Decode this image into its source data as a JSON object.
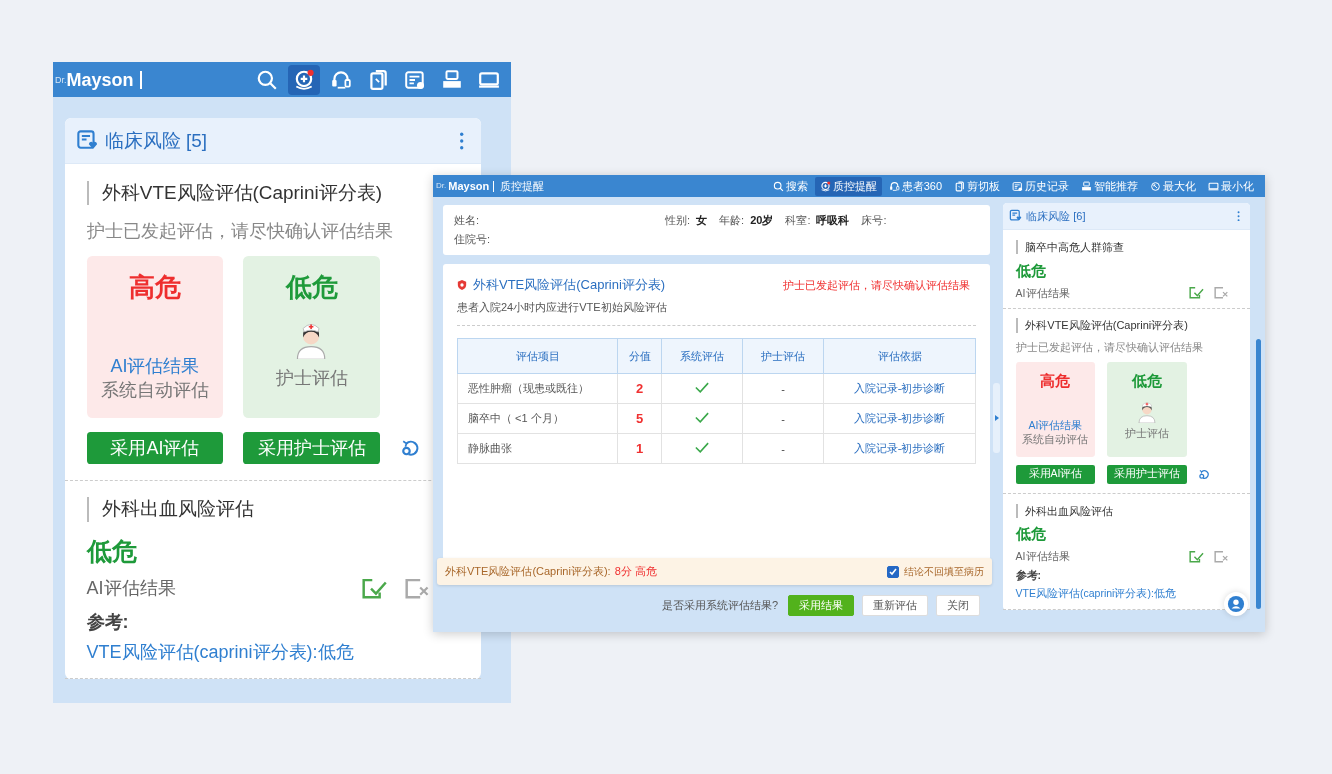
{
  "left_window": {
    "brand_prefix": "Dr.",
    "brand": "Mayson",
    "toolbar": [
      {
        "kind": "search",
        "selected": false
      },
      {
        "kind": "quality",
        "selected": true
      },
      {
        "kind": "patient",
        "selected": false
      },
      {
        "kind": "clipboard",
        "selected": false
      },
      {
        "kind": "history",
        "selected": false
      },
      {
        "kind": "recommend",
        "selected": false
      },
      {
        "kind": "minimize",
        "selected": false
      }
    ],
    "panel": {
      "title": "临床风险",
      "count": "[5]",
      "items": [
        {
          "kind": "dual",
          "title": "外科VTE风险评估(Caprini评分表)",
          "note": "护士已发起评估，请尽快确认评估结果",
          "cards": [
            {
              "kind": "ai",
              "high_risk": true,
              "rating": "高危",
              "source": "AI评估结果",
              "caption": "系统自动评估"
            },
            {
              "kind": "nurse",
              "high_risk": false,
              "rating": "低危",
              "caption": "护士评估"
            }
          ],
          "buttons": [
            "采用AI评估",
            "采用护士评估"
          ]
        },
        {
          "kind": "single",
          "title": "外科出血风险评估",
          "high_risk": false,
          "rating": "低危",
          "source": "AI评估结果",
          "reference_label": "参考:",
          "reference": "VTE风险评估(caprini评分表):低危"
        }
      ]
    }
  },
  "main_window": {
    "brand_prefix": "Dr.",
    "brand": "Mayson",
    "title": "质控提醒",
    "toolbar": [
      {
        "kind": "search",
        "label": "搜索",
        "selected": false
      },
      {
        "kind": "quality",
        "label": "质控提醒",
        "selected": true
      },
      {
        "kind": "patient",
        "label": "患者360",
        "selected": false
      },
      {
        "kind": "clipboard",
        "label": "剪切板",
        "selected": false
      },
      {
        "kind": "history",
        "label": "历史记录",
        "selected": false
      },
      {
        "kind": "recommend",
        "label": "智能推荐",
        "selected": false
      },
      {
        "kind": "maximize",
        "label": "最大化",
        "selected": false
      },
      {
        "kind": "minimize",
        "label": "最小化",
        "selected": false
      }
    ],
    "patient": {
      "name_label": "姓名:",
      "fields": [
        {
          "label": "性别:",
          "value": "女"
        },
        {
          "label": "年龄:",
          "value": "20岁"
        },
        {
          "label": "科室:",
          "value": "呼吸科"
        },
        {
          "label": "床号:"
        }
      ],
      "admission_label": "住院号:"
    },
    "assessment": {
      "title": "外科VTE风险评估(Caprini评分表)",
      "alert": "护士已发起评估，请尽快确认评估结果",
      "subtitle": "患者入院24小时内应进行VTE初始风险评估",
      "table": {
        "columns": [
          "评估项目",
          "分值",
          "系统评估",
          "护士评估",
          "评估依据"
        ],
        "rows": [
          {
            "item": "恶性肿瘤（现患或既往）",
            "score": "2",
            "system_checked": true,
            "nurse": "-",
            "basis": "入院记录-初步诊断"
          },
          {
            "item": "脑卒中（ <1 个月）",
            "score": "5",
            "system_checked": true,
            "nurse": "-",
            "basis": "入院记录-初步诊断"
          },
          {
            "item": "静脉曲张",
            "score": "1",
            "system_checked": true,
            "nurse": "-",
            "basis": "入院记录-初步诊断"
          }
        ]
      }
    },
    "result": {
      "label": "外科VTE风险评估(Caprini评分表):",
      "score": "8分 高危",
      "no_backfill": {
        "label": "结论不回填至病历",
        "checked": true
      }
    },
    "footer": {
      "question": "是否采用系统评估结果?",
      "buttons": [
        {
          "kind": "primary",
          "label": "采用结果"
        },
        {
          "kind": "default",
          "label": "重新评估"
        },
        {
          "kind": "default",
          "label": "关闭"
        }
      ]
    },
    "sidebar": {
      "title": "临床风险",
      "count": "[6]",
      "items": [
        {
          "kind": "single",
          "title": "脑卒中高危人群筛查",
          "high_risk": false,
          "rating": "低危",
          "source": "AI评估结果"
        },
        {
          "kind": "dual",
          "title": "外科VTE风险评估(Caprini评分表)",
          "note": "护士已发起评估，请尽快确认评估结果",
          "cards": [
            {
              "kind": "ai",
              "high_risk": true,
              "rating": "高危",
              "source": "AI评估结果",
              "caption": "系统自动评估"
            },
            {
              "kind": "nurse",
              "high_risk": false,
              "rating": "低危",
              "caption": "护士评估"
            }
          ],
          "buttons": [
            "采用AI评估",
            "采用护士评估"
          ]
        },
        {
          "kind": "single",
          "title": "外科出血风险评估",
          "high_risk": false,
          "rating": "低危",
          "source": "AI评估结果",
          "reference_label": "参考:",
          "reference": "VTE风险评估(caprini评分表):低危"
        }
      ]
    }
  }
}
